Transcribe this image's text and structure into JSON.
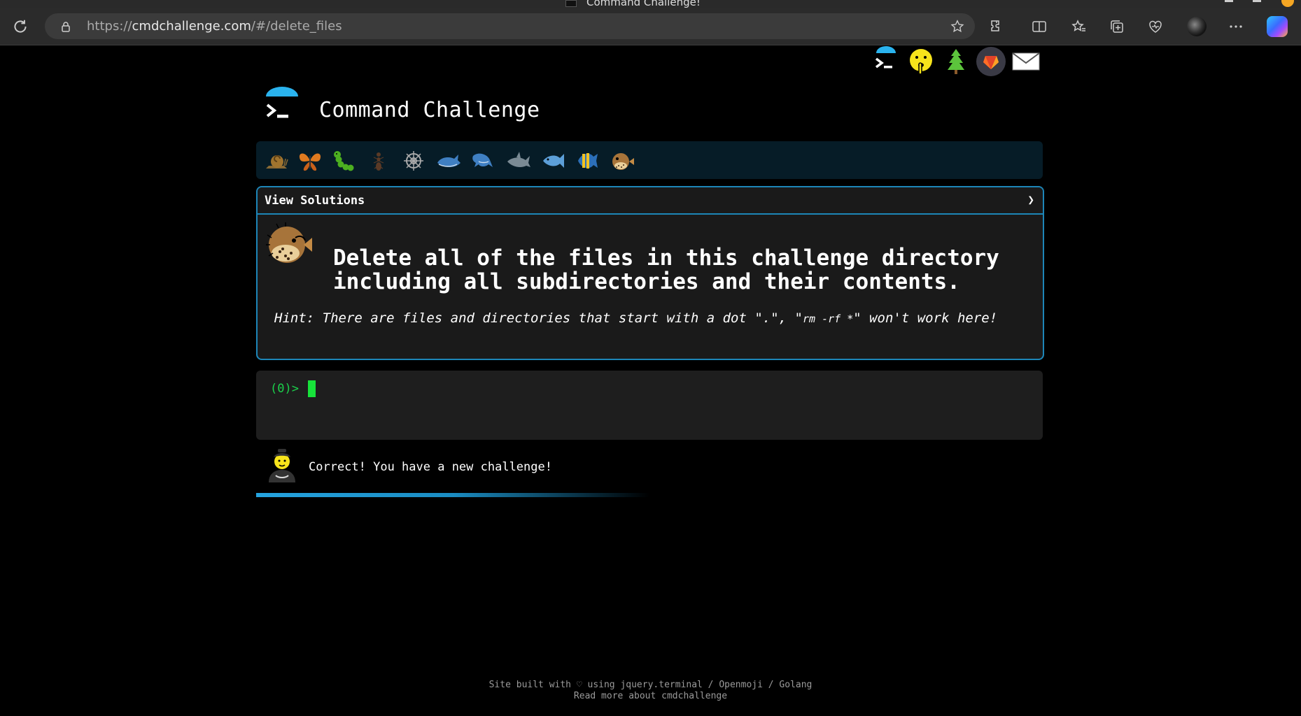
{
  "browser": {
    "tab_title": "Command Challenge!",
    "url_prefix": "https://",
    "url_host": "cmdchallenge.com",
    "url_path": "/#/delete_files",
    "toolbar_icons": [
      "extensions-icon",
      "split-screen-icon",
      "favorites-icon",
      "collections-icon",
      "browser-essentials-icon",
      "profile-avatar",
      "more-menu-icon",
      "copilot-icon"
    ]
  },
  "site_icons": [
    "terminal-logo-icon",
    "shushing-face-icon",
    "tree-icon",
    "gitlab-icon",
    "mail-icon"
  ],
  "header": {
    "title": "Command Challenge"
  },
  "emoji_bar": {
    "items": [
      "snail-icon",
      "butterfly-icon",
      "caterpillar-icon",
      "ant-icon",
      "compass-icon",
      "whale-icon",
      "dolphin-icon",
      "shark-icon",
      "fish-icon",
      "tropical-fish-icon",
      "blowfish-icon"
    ]
  },
  "challenge": {
    "solutions_label": "View Solutions",
    "chevron": "❯",
    "description": "Delete all of the files in this challenge directory including all subdirectories and their contents.",
    "hint_prefix": "Hint: There are files and directories that start with a dot \".\", \"",
    "hint_code": "rm -rf *",
    "hint_suffix": "\" won't work here!"
  },
  "terminal": {
    "prompt": "(0)>"
  },
  "status": {
    "message": "Correct! You have a new challenge!",
    "progress": 0.5
  },
  "footer": {
    "line1": "Site built with ♡ using jquery.terminal / Openmoji / Golang",
    "line2": "Read more about cmdchallenge"
  },
  "colors": {
    "accent": "#1d86b8",
    "prompt_green": "#1bd14b",
    "emoji_bar_bg": "#061c27"
  }
}
